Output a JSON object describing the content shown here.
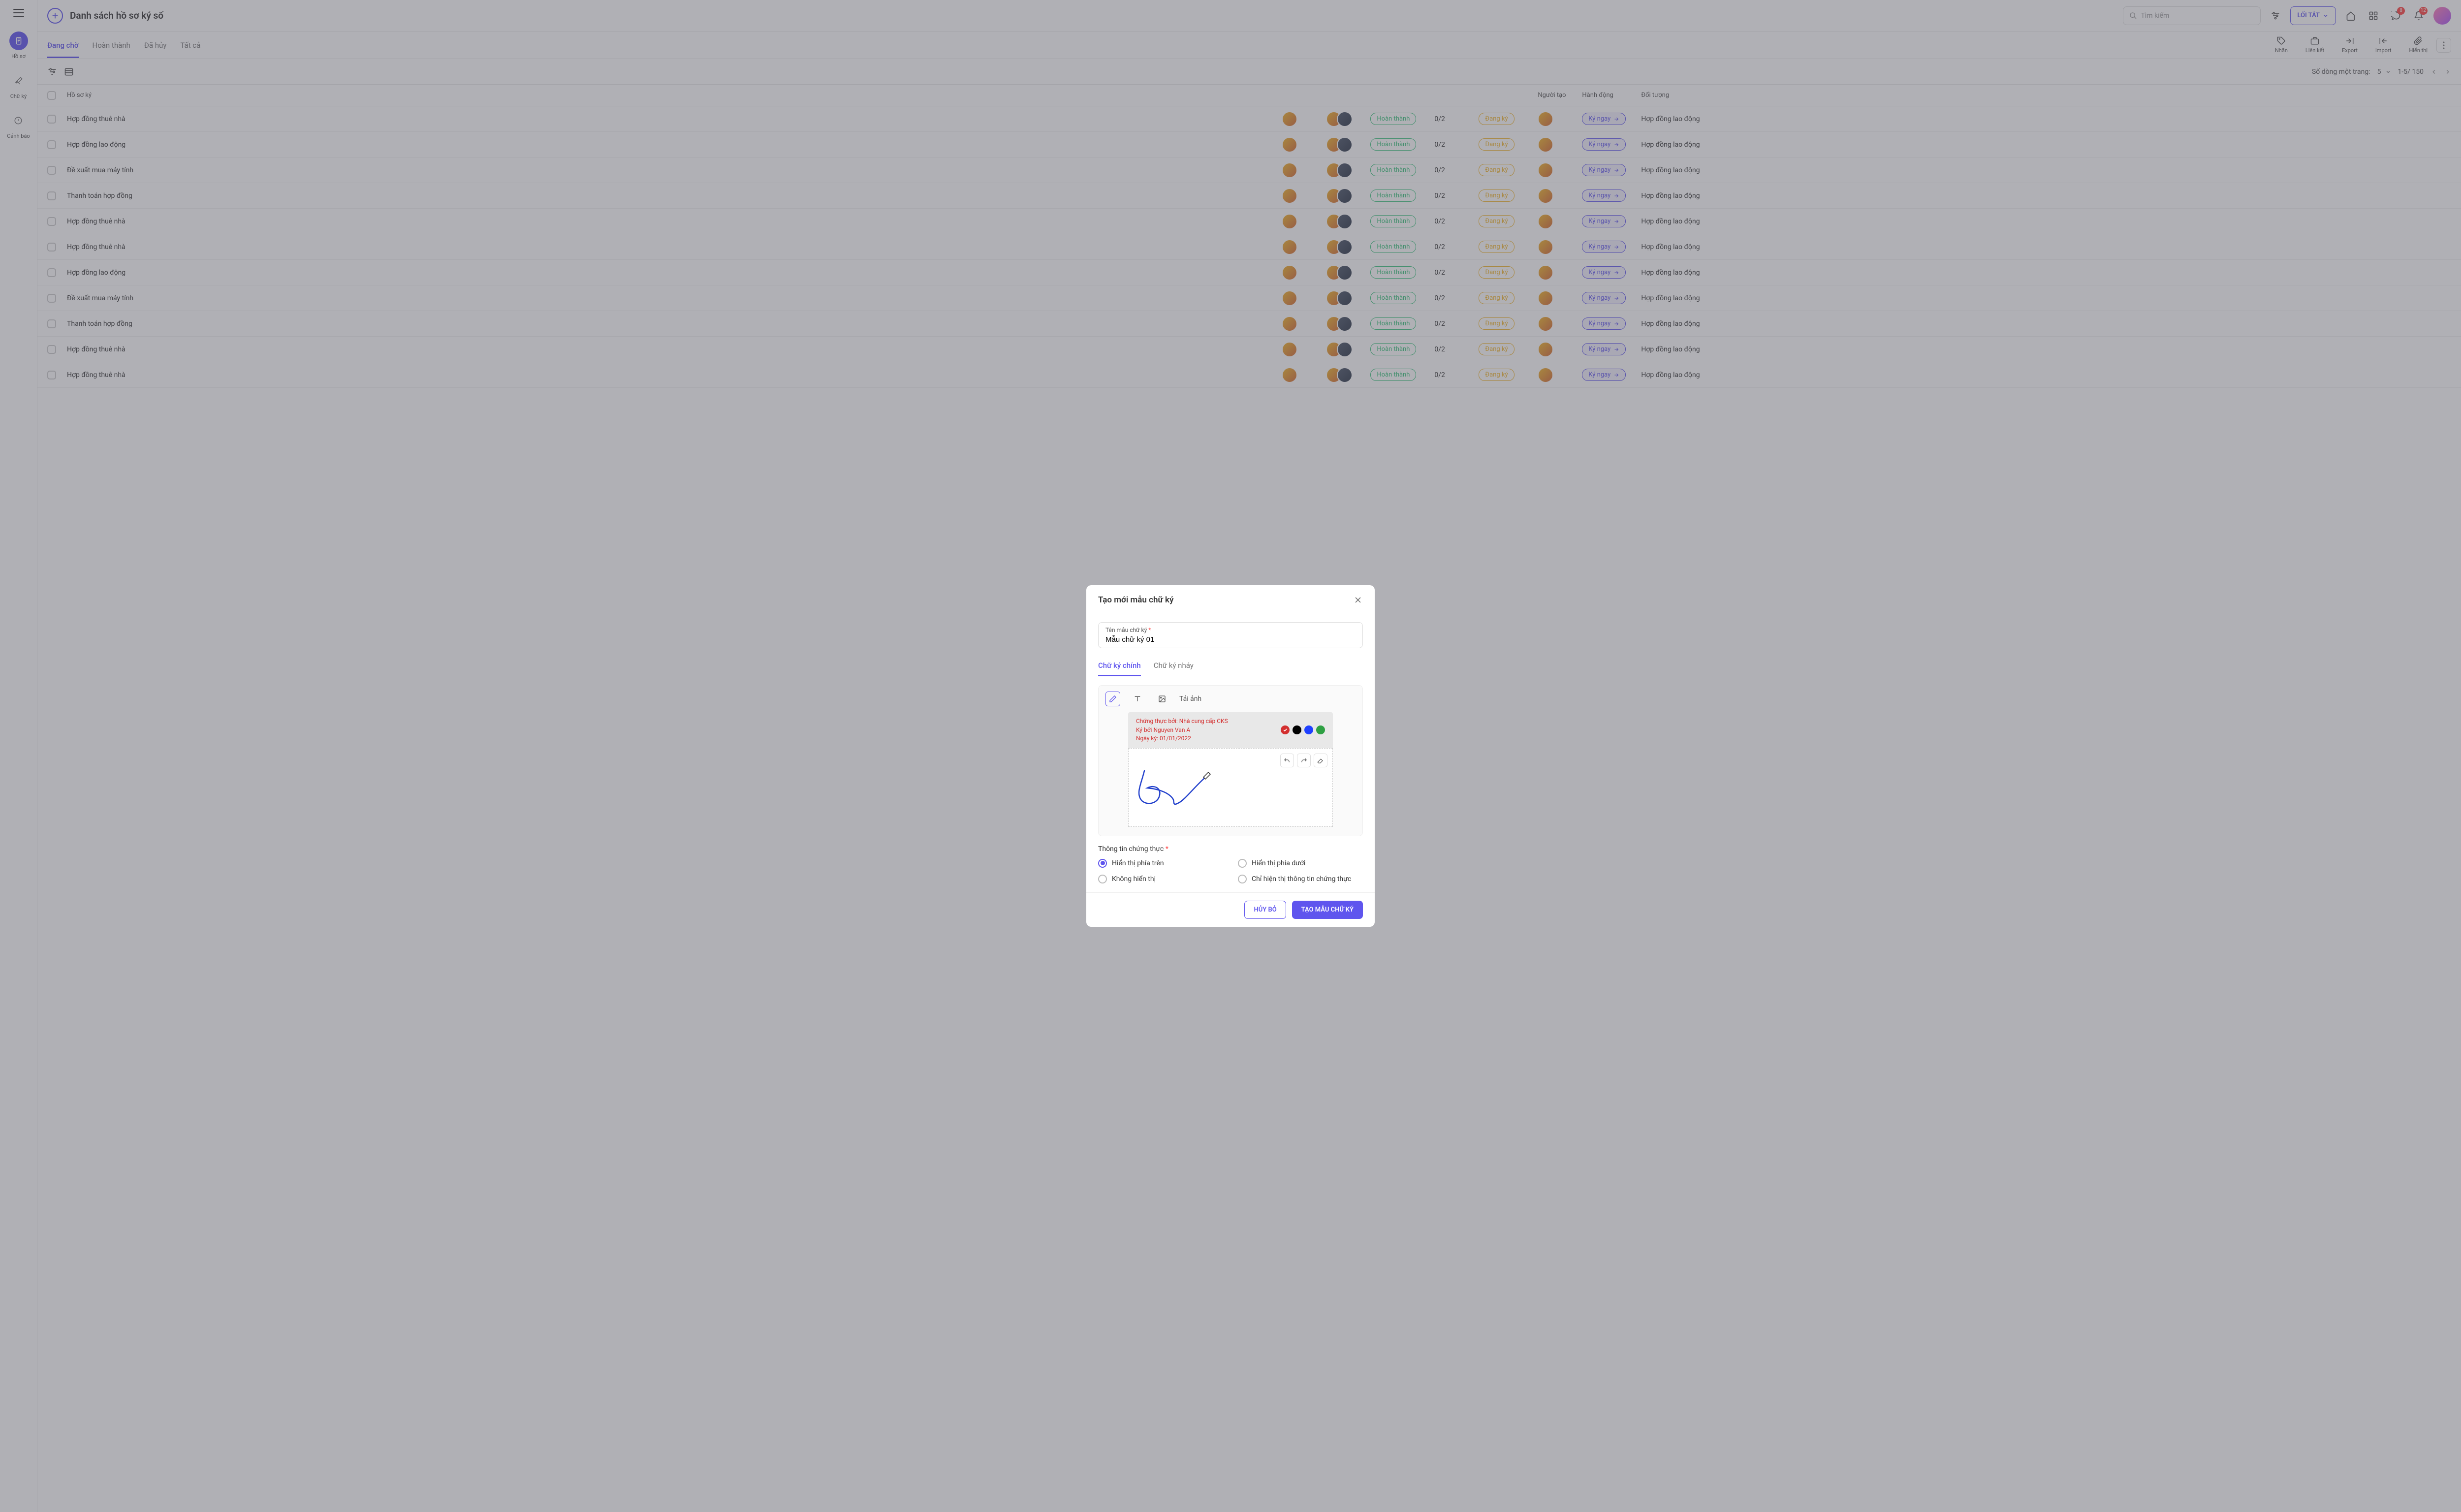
{
  "sidebar": {
    "items": [
      {
        "label": "Hồ sơ"
      },
      {
        "label": "Chữ ký"
      },
      {
        "label": "Cảnh báo"
      }
    ]
  },
  "header": {
    "title": "Danh sách hồ sơ ký số",
    "search_placeholder": "Tìm kiếm",
    "shortcut": "LỐI TẮT",
    "badges": {
      "message": "8",
      "bell": "12"
    }
  },
  "tabs": [
    "Đang chờ",
    "Hoàn thành",
    "Đã hủy",
    "Tất cả"
  ],
  "toolbar": [
    {
      "label": "Nhãn"
    },
    {
      "label": "Liên kết"
    },
    {
      "label": "Export"
    },
    {
      "label": "Import"
    },
    {
      "label": "Hiển thị"
    }
  ],
  "pagination": {
    "label": "Số dòng một trang:",
    "size": "5",
    "range": "1-5/ 150"
  },
  "columns": {
    "name": "Hồ sơ ký",
    "creator": "Người tạo",
    "action": "Hành động",
    "object": "Đối tượng"
  },
  "rows": [
    {
      "name": "Hợp đồng thuê nhà",
      "status1": "Hoàn thành",
      "progress": "0/2",
      "status2": "Đang ký",
      "action": "Ký ngay",
      "object": "Hợp đồng lao động"
    },
    {
      "name": "Hợp đồng lao động",
      "status1": "Hoàn thành",
      "progress": "0/2",
      "status2": "Đang ký",
      "action": "Ký ngay",
      "object": "Hợp đồng lao động"
    },
    {
      "name": "Đề xuất mua máy tính",
      "status1": "Hoàn thành",
      "progress": "0/2",
      "status2": "Đang ký",
      "action": "Ký ngay",
      "object": "Hợp đồng lao động"
    },
    {
      "name": "Thanh toán hợp đồng",
      "status1": "Hoàn thành",
      "progress": "0/2",
      "status2": "Đang ký",
      "action": "Ký ngay",
      "object": "Hợp đồng lao động"
    },
    {
      "name": "Hợp đồng thuê nhà",
      "status1": "Hoàn thành",
      "progress": "0/2",
      "status2": "Đang ký",
      "action": "Ký ngay",
      "object": "Hợp đồng lao động"
    },
    {
      "name": "Hợp đồng thuê nhà",
      "status1": "Hoàn thành",
      "progress": "0/2",
      "status2": "Đang ký",
      "action": "Ký ngay",
      "object": "Hợp đồng lao động"
    },
    {
      "name": "Hợp đồng lao động",
      "status1": "Hoàn thành",
      "progress": "0/2",
      "status2": "Đang ký",
      "action": "Ký ngay",
      "object": "Hợp đồng lao động"
    },
    {
      "name": "Đề xuất mua máy tính",
      "status1": "Hoàn thành",
      "progress": "0/2",
      "status2": "Đang ký",
      "action": "Ký ngay",
      "object": "Hợp đồng lao động"
    },
    {
      "name": "Thanh toán hợp đồng",
      "status1": "Hoàn thành",
      "progress": "0/2",
      "status2": "Đang ký",
      "action": "Ký ngay",
      "object": "Hợp đồng lao động"
    },
    {
      "name": "Hợp đồng thuê nhà",
      "status1": "Hoàn thành",
      "progress": "0/2",
      "status2": "Đang ký",
      "action": "Ký ngay",
      "object": "Hợp đồng lao động"
    },
    {
      "name": "Hợp đồng thuê nhà",
      "status1": "Hoàn thành",
      "progress": "0/2",
      "status2": "Đang ký",
      "action": "Ký ngay",
      "object": "Hợp đồng lao động"
    }
  ],
  "modal": {
    "title": "Tạo mới mẫu chữ ký",
    "name_label": "Tên mẫu chữ ký",
    "name_value": "Mẫu chữ ký 01",
    "tabs": [
      "Chữ ký chính",
      "Chữ ký nháy"
    ],
    "upload": "Tải ảnh",
    "cert": {
      "line1": "Chứng thực bởi: Nhà cung cấp CKS",
      "line2": "Ký bởi Nguyen Van A",
      "line3": "Ngày ký: 01/01/2022"
    },
    "colors": [
      "#d32f2f",
      "#000000",
      "#1e40ff",
      "#2ea043"
    ],
    "auth_label": "Thông tin chứng thực",
    "radios": [
      "Hiển thị phía trên",
      "Hiển thị phía dưới",
      "Không hiển thị",
      "Chỉ hiện thị thông tin chứng thực"
    ],
    "cancel": "HỦY BỎ",
    "submit": "TẠO MẪU CHỮ KÝ"
  }
}
